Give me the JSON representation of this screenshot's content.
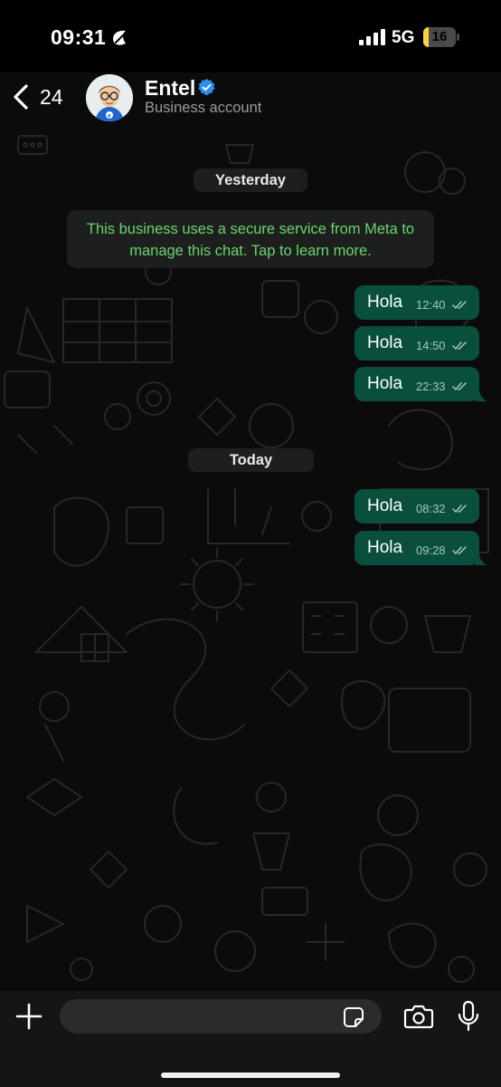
{
  "status_bar": {
    "time": "09:31",
    "focus_icon": "moon-leaf-icon",
    "signal_icon": "cellular-signal-icon",
    "network": "5G",
    "battery": "16",
    "battery_level": 0.16,
    "battery_color": "#f6d33c"
  },
  "header": {
    "back_icon": "chevron-left-icon",
    "back_count": "24",
    "contact_name": "Entel",
    "verified_icon": "verified-badge-icon",
    "verified_color": "#2e8cf5",
    "subtitle": "Business account"
  },
  "chat": {
    "groups": [
      {
        "date_label": "Yesterday",
        "notice": "This business uses a secure service from Meta to manage this chat. Tap to learn more.",
        "messages": [
          {
            "text": "Hola",
            "time": "12:40",
            "status_icon": "double-check-icon"
          },
          {
            "text": "Hola",
            "time": "14:50",
            "status_icon": "double-check-icon"
          },
          {
            "text": "Hola",
            "time": "22:33",
            "status_icon": "double-check-icon"
          }
        ]
      },
      {
        "date_label": "Today",
        "messages": [
          {
            "text": "Hola",
            "time": "08:32",
            "status_icon": "double-check-icon"
          },
          {
            "text": "Hola",
            "time": "09:28",
            "status_icon": "double-check-icon"
          }
        ]
      }
    ],
    "bubble_color": "#0a4f3e",
    "notice_text_color": "#6ad46a"
  },
  "input_bar": {
    "plus_icon": "plus-icon",
    "placeholder": "",
    "value": "",
    "sticker_icon": "sticker-icon",
    "camera_icon": "camera-icon",
    "mic_icon": "microphone-icon"
  }
}
